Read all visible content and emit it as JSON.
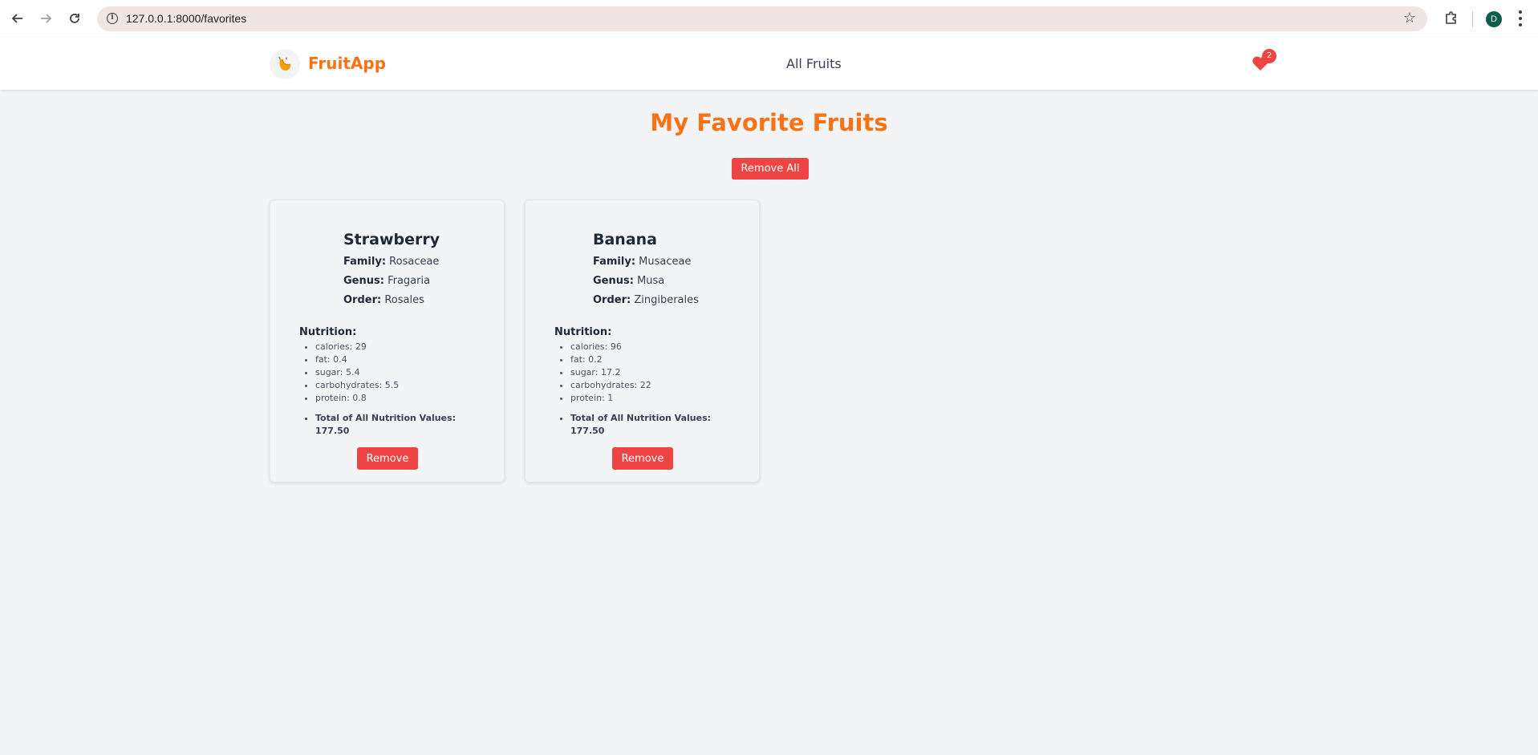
{
  "browser": {
    "url": "127.0.0.1:8000/favorites",
    "profile_initial": "D",
    "back_icon": "back-arrow-icon",
    "forward_icon": "forward-arrow-icon",
    "reload_icon": "reload-icon"
  },
  "header": {
    "brand": "FruitApp",
    "nav_link": "All Fruits",
    "favorites_count": "2",
    "accent_color": "#f97316",
    "danger_color": "#ef4444"
  },
  "main": {
    "title": "My Favorite Fruits",
    "remove_all_label": "Remove All"
  },
  "fruits": [
    {
      "name": "Strawberry",
      "family_label": "Family:",
      "family": "Rosaceae",
      "genus_label": "Genus:",
      "genus": "Fragaria",
      "order_label": "Order:",
      "order": "Rosales",
      "nutrition_title": "Nutrition:",
      "nutrition": [
        "calories: 29",
        "fat: 0.4",
        "sugar: 5.4",
        "carbohydrates: 5.5",
        "protein: 0.8"
      ],
      "total_label": "Total of All Nutrition Values:",
      "total_value": "177.50",
      "remove_label": "Remove"
    },
    {
      "name": "Banana",
      "family_label": "Family:",
      "family": "Musaceae",
      "genus_label": "Genus:",
      "genus": "Musa",
      "order_label": "Order:",
      "order": "Zingiberales",
      "nutrition_title": "Nutrition:",
      "nutrition": [
        "calories: 96",
        "fat: 0.2",
        "sugar: 17.2",
        "carbohydrates: 22",
        "protein: 1"
      ],
      "total_label": "Total of All Nutrition Values:",
      "total_value": "177.50",
      "remove_label": "Remove"
    }
  ]
}
